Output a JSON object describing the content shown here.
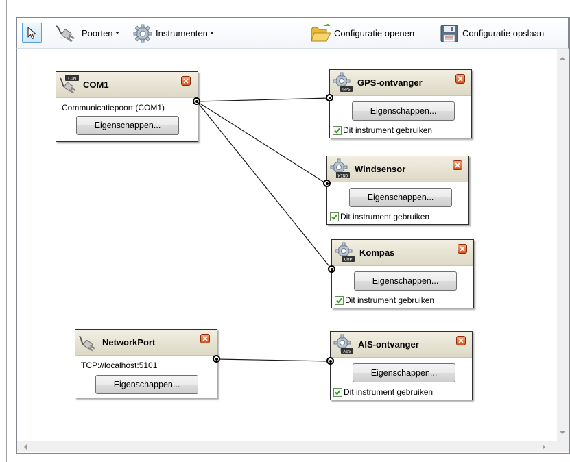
{
  "toolbar": {
    "pointer_icon": "arrow-pointer-icon",
    "ports_label": "Poorten",
    "instruments_label": "Instrumenten",
    "open_config_label": "Configuratie openen",
    "save_config_label": "Configuratie opslaan"
  },
  "ports": [
    {
      "name": "COM1",
      "icon_badge": "COM",
      "description": "Communicatiepoort (COM1)",
      "properties_label": "Eigenschappen..."
    },
    {
      "name": "NetworkPort",
      "description": "TCP://localhost:5101",
      "properties_label": "Eigenschappen..."
    }
  ],
  "instruments": [
    {
      "name": "GPS-ontvanger",
      "icon_badge": "GPS",
      "properties_label": "Eigenschappen...",
      "use_label": "Dit instrument gebruiken",
      "use_checked": true
    },
    {
      "name": "Windsensor",
      "icon_badge": "WIND",
      "properties_label": "Eigenschappen...",
      "use_label": "Dit instrument gebruiken",
      "use_checked": true
    },
    {
      "name": "Kompas",
      "icon_badge": "CMP",
      "properties_label": "Eigenschappen...",
      "use_label": "Dit instrument gebruiken",
      "use_checked": true
    },
    {
      "name": "AIS-ontvanger",
      "icon_badge": "AIS",
      "properties_label": "Eigenschappen...",
      "use_label": "Dit instrument gebruiken",
      "use_checked": true
    }
  ],
  "colors": {
    "header_top": "#f2efe3",
    "header_bottom": "#ddd8c5",
    "close_button": "#e06a32",
    "check": "#2e9a2e"
  }
}
